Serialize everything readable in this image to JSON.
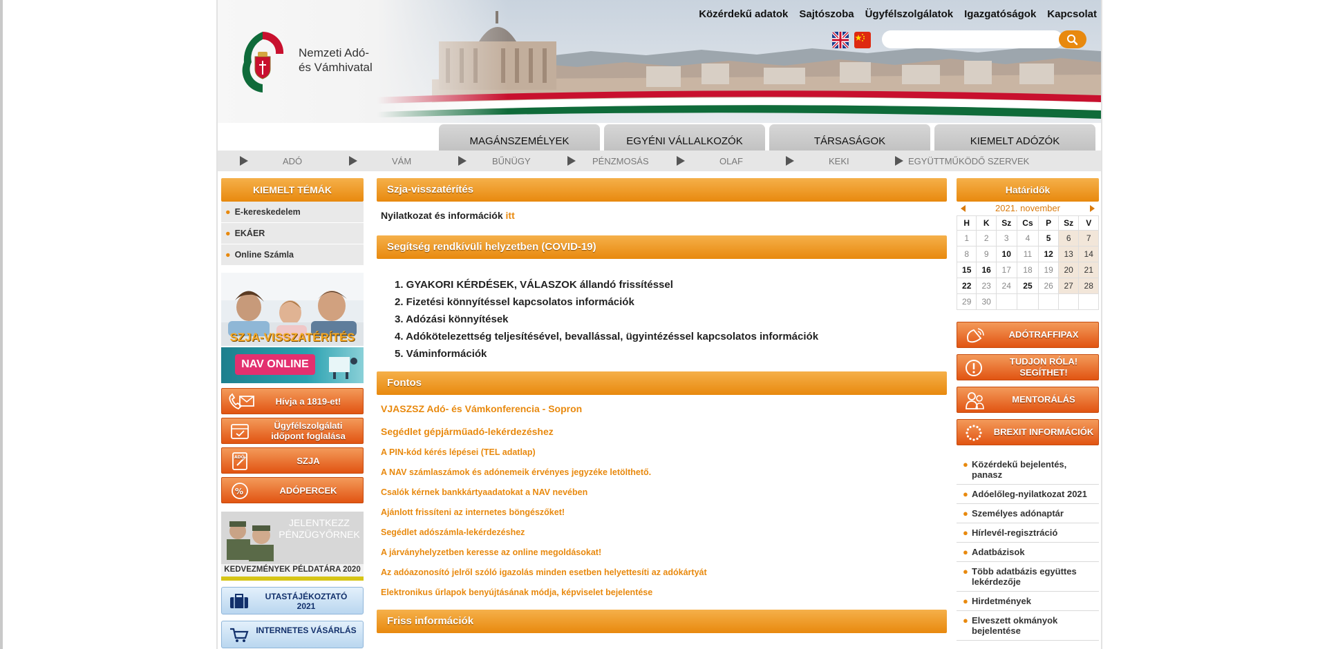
{
  "header": {
    "org_line1": "Nemzeti Adó-",
    "org_line2": "és Vámhivatal",
    "top_links": [
      "Közérdekű adatok",
      "Sajtószoba",
      "Ügyfélszolgálatok",
      "Igazgatóságok",
      "Kapcsolat"
    ],
    "search_placeholder": ""
  },
  "main_nav": [
    "MAGÁNSZEMÉLYEK",
    "EGYÉNI VÁLLALKOZÓK",
    "TÁRSASÁGOK",
    "KIEMELT ADÓZÓK"
  ],
  "sub_nav": [
    "ADÓ",
    "VÁM",
    "BŰNÜGY",
    "PÉNZMOSÁS",
    "OLAF",
    "KEKI",
    "EGYÜTTMŰKÖDŐ SZERVEK"
  ],
  "left_sidebar": {
    "heading": "KIEMELT TÉMÁK",
    "items": [
      "E-kereskedelem",
      "EKÁER",
      "Online Számla"
    ],
    "banner_szja": "SZJA-VISSZATÉRÍTÉS",
    "banner_nav_online": "NAV ONLINE",
    "buttons": [
      "Hívja a 1819-et!",
      "Ügyfélszolgálati időpont foglalása",
      "SZJA",
      "ADÓPERCEK"
    ],
    "szja_icon_text": "ADÓ",
    "recruit_line1": "JELENTKEZZ",
    "recruit_line2": "PÉNZÜGYŐRNEK",
    "kedvezmenyek": "KEDVEZMÉNYEK PÉLDATÁRA 2020",
    "blue_buttons": [
      "UTASTÁJÉKOZTATÓ 2021",
      "INTERNETES VÁSÁRLÁS"
    ]
  },
  "center": {
    "szja_title": "Szja-visszatérítés",
    "nyilatkozat_text": "Nyilatkozat és információk",
    "nyilatkozat_link": "itt",
    "covid_title": "Segítség rendkívüli helyzetben (COVID-19)",
    "covid_items": [
      "1. GYAKORI KÉRDÉSEK, VÁLASZOK állandó frissítéssel",
      "2. Fizetési könnyítéssel kapcsolatos információk",
      "3. Adózási könnyítések",
      "4. Adókötelezettség teljesítésével, bevallással, ügyintézéssel kapcsolatos információk",
      "5. Váminformációk"
    ],
    "fontos_title": "Fontos",
    "fontos_links": [
      "VJASZSZ  Adó- és Vámkonferencia - Sopron",
      "Segédlet gépjárműadó-lekérdezéshez",
      "A PIN-kód kérés lépései (TEL adatlap)",
      "A NAV számlaszámok és adónemeik érvényes jegyzéke letölthető.",
      "Csalók kérnek bankkártyaadatokat a NAV nevében",
      "Ajánlott frissíteni az internetes böngészőket!",
      "Segédlet adószámla-lekérdezéshez",
      "A járványhelyzetben keresse az online megoldásokat!",
      "Az adóazonosító jelről szóló igazolás minden esetben helyettesíti az adókártyát",
      "Elektronikus űrlapok benyújtásának módja, képviselet bejelentése"
    ],
    "friss_title": "Friss információk"
  },
  "right_sidebar": {
    "calendar_title": "Határidők",
    "month": "2021. november",
    "weekdays": [
      "H",
      "K",
      "Sz",
      "Cs",
      "P",
      "Sz",
      "V"
    ],
    "weeks": [
      [
        "1",
        "2",
        "3",
        "4",
        "5",
        "6",
        "7"
      ],
      [
        "8",
        "9",
        "10",
        "11",
        "12",
        "13",
        "14"
      ],
      [
        "15",
        "16",
        "17",
        "18",
        "19",
        "20",
        "21"
      ],
      [
        "22",
        "23",
        "24",
        "25",
        "26",
        "27",
        "28"
      ],
      [
        "29",
        "30",
        "",
        "",
        "",
        "",
        ""
      ]
    ],
    "deadline_days": [
      "5",
      "10",
      "12",
      "15",
      "16",
      "22",
      "25"
    ],
    "buttons": [
      "ADÓTRAFFIPAX",
      "TUDJON RÓLA! SEGÍTHET!",
      "MENTORÁLÁS",
      "BREXIT INFORMÁCIÓK"
    ],
    "links": [
      "Közérdekű bejelentés, panasz",
      "Adóelőleg-nyilatkozat 2021",
      "Személyes adónaptár",
      "Hírlevél-regisztráció",
      "Adatbázisok",
      "Több adatbázis együttes lekérdezője",
      "Hirdetmények",
      "Elveszett okmányok bejelentése"
    ]
  },
  "colors": {
    "accent_orange": "#e8890e",
    "button_orange": "#e15412",
    "blue_button": "#b9d6ef"
  }
}
